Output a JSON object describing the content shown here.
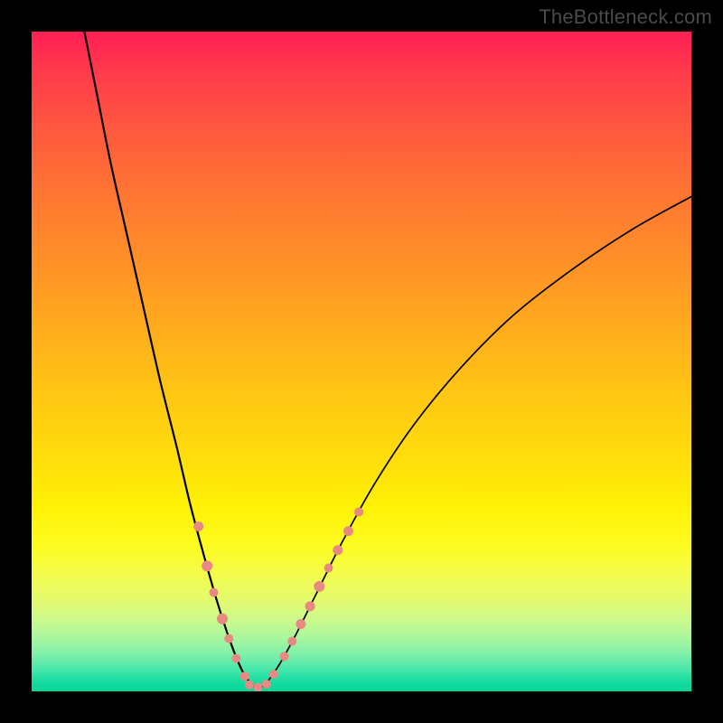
{
  "watermark": {
    "text": "TheBottleneck.com"
  },
  "chart_data": {
    "type": "line",
    "title": "",
    "xlabel": "",
    "ylabel": "",
    "xlim": [
      0,
      100
    ],
    "ylim": [
      0,
      100
    ],
    "left_curve": {
      "name": "left-branch",
      "type": "line",
      "points": [
        {
          "x": 8.0,
          "y": 100.0
        },
        {
          "x": 10.0,
          "y": 90.0
        },
        {
          "x": 12.0,
          "y": 80.0
        },
        {
          "x": 14.5,
          "y": 69.0
        },
        {
          "x": 17.0,
          "y": 58.0
        },
        {
          "x": 19.5,
          "y": 47.0
        },
        {
          "x": 22.0,
          "y": 37.0
        },
        {
          "x": 24.0,
          "y": 28.5
        },
        {
          "x": 26.0,
          "y": 21.0
        },
        {
          "x": 28.0,
          "y": 14.0
        },
        {
          "x": 29.6,
          "y": 9.0
        },
        {
          "x": 31.0,
          "y": 5.2
        },
        {
          "x": 32.2,
          "y": 2.6
        },
        {
          "x": 33.4,
          "y": 1.0
        },
        {
          "x": 34.3,
          "y": 0.3
        }
      ]
    },
    "right_curve": {
      "name": "right-branch",
      "type": "line",
      "points": [
        {
          "x": 34.3,
          "y": 0.3
        },
        {
          "x": 35.5,
          "y": 1.2
        },
        {
          "x": 37.5,
          "y": 4.0
        },
        {
          "x": 40.0,
          "y": 8.5
        },
        {
          "x": 43.0,
          "y": 14.5
        },
        {
          "x": 47.0,
          "y": 22.5
        },
        {
          "x": 52.0,
          "y": 31.5
        },
        {
          "x": 58.0,
          "y": 40.5
        },
        {
          "x": 65.0,
          "y": 49.0
        },
        {
          "x": 73.0,
          "y": 57.0
        },
        {
          "x": 82.0,
          "y": 64.0
        },
        {
          "x": 91.0,
          "y": 70.0
        },
        {
          "x": 100.0,
          "y": 75.0
        }
      ]
    },
    "markers_left": {
      "name": "left-markers",
      "type": "scatter",
      "points": [
        {
          "x": 25.3,
          "y": 25.0,
          "r": 5.5
        },
        {
          "x": 26.6,
          "y": 19.0,
          "r": 6.0
        },
        {
          "x": 27.6,
          "y": 15.0,
          "r": 5.0
        },
        {
          "x": 28.9,
          "y": 11.0,
          "r": 6.0
        },
        {
          "x": 29.9,
          "y": 8.0,
          "r": 5.0
        },
        {
          "x": 31.0,
          "y": 5.0,
          "r": 5.0
        },
        {
          "x": 32.3,
          "y": 2.3,
          "r": 5.0
        }
      ]
    },
    "markers_bottom": {
      "name": "bottom-markers",
      "type": "scatter",
      "points": [
        {
          "x": 33.0,
          "y": 1.0,
          "r": 5.0
        },
        {
          "x": 34.3,
          "y": 0.6,
          "r": 5.0
        },
        {
          "x": 35.6,
          "y": 1.1,
          "r": 5.0
        }
      ]
    },
    "markers_right": {
      "name": "right-markers",
      "type": "scatter",
      "points": [
        {
          "x": 36.7,
          "y": 2.6,
          "r": 5.0
        },
        {
          "x": 38.3,
          "y": 5.3,
          "r": 5.0
        },
        {
          "x": 39.5,
          "y": 7.6,
          "r": 5.0
        },
        {
          "x": 40.8,
          "y": 10.2,
          "r": 5.5
        },
        {
          "x": 42.2,
          "y": 12.9,
          "r": 5.5
        },
        {
          "x": 43.6,
          "y": 15.9,
          "r": 6.0
        },
        {
          "x": 45.0,
          "y": 18.7,
          "r": 5.0
        },
        {
          "x": 46.4,
          "y": 21.4,
          "r": 5.5
        },
        {
          "x": 48.0,
          "y": 24.3,
          "r": 5.5
        },
        {
          "x": 49.6,
          "y": 27.2,
          "r": 5.0
        }
      ]
    }
  },
  "colors": {
    "curve": "#000000",
    "marker": "#e88a82"
  }
}
